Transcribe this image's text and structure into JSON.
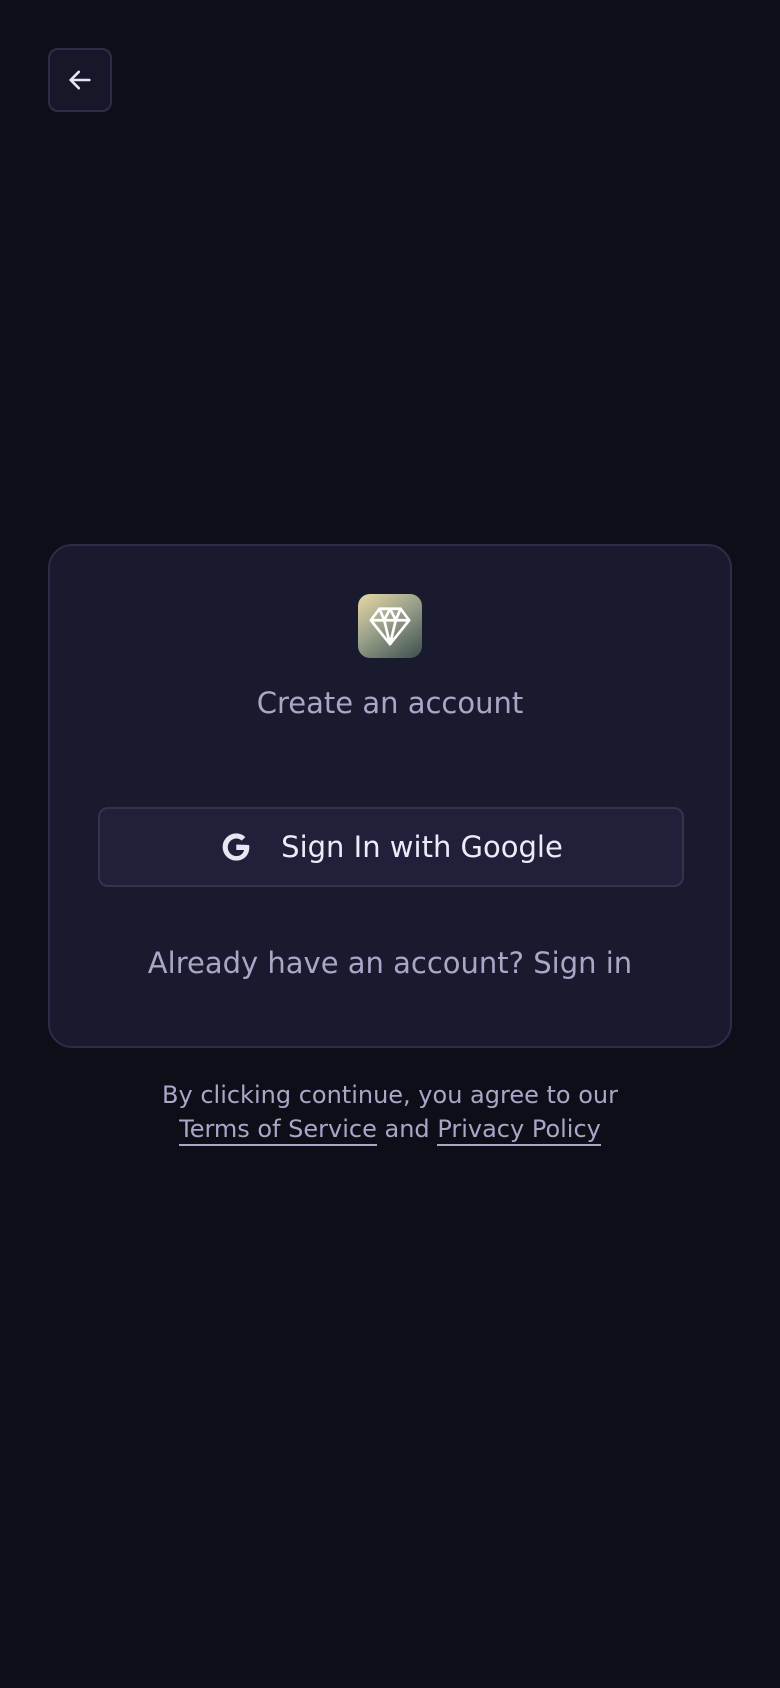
{
  "header": {
    "back_icon": "arrow-left-icon"
  },
  "card": {
    "logo_icon": "diamond-icon",
    "title": "Create an account",
    "google_button": {
      "icon": "google-icon",
      "label": "Sign In with Google"
    },
    "signin_prompt": {
      "text": "Already have an account?",
      "link": "Sign in"
    }
  },
  "legal": {
    "line1": "By clicking continue, you agree to our",
    "terms": "Terms of Service",
    "and": "and",
    "privacy": "Privacy Policy"
  },
  "colors": {
    "background": "#0e0e18",
    "card": "#1a1a2e",
    "border": "#2e2b4a",
    "muted_text": "#a9a6c7",
    "primary_text": "#eeeaf7"
  }
}
